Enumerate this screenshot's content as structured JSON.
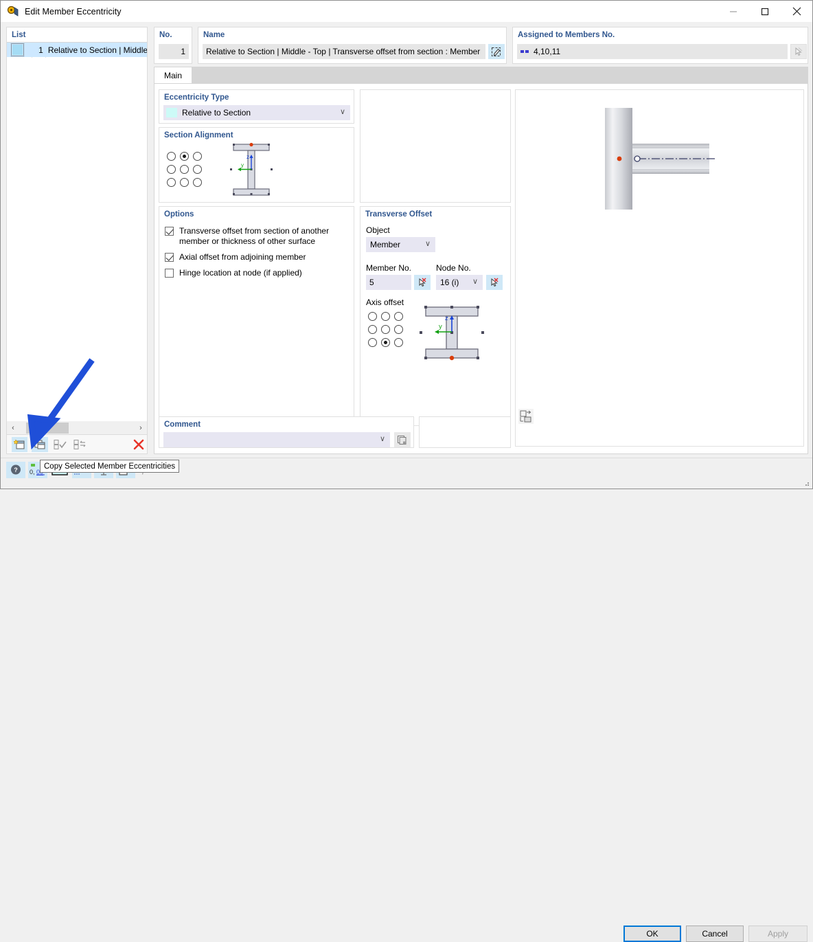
{
  "window": {
    "title": "Edit Member Eccentricity",
    "icon": "eccentricity-icon",
    "minimize": "—",
    "maximize": "☐",
    "close": "✕"
  },
  "list_panel": {
    "header": "List",
    "rows": [
      {
        "no": "1",
        "text": "Relative to Section | Middle - To"
      }
    ],
    "scroll_left": "‹",
    "scroll_right": "›",
    "toolbar": [
      {
        "name": "new-member-eccentricity-button",
        "glyph": "new"
      },
      {
        "name": "copy-selected-member-eccentricities-button",
        "glyph": "copy"
      },
      {
        "name": "select-all-button",
        "glyph": "check-all"
      },
      {
        "name": "invert-selection-button",
        "glyph": "invert"
      },
      {
        "name": "delete-button",
        "glyph": "delete"
      }
    ]
  },
  "no_panel": {
    "label": "No.",
    "value": "1"
  },
  "name_panel": {
    "label": "Name",
    "value": "Relative to Section | Middle - Top | Transverse offset from section : Member No",
    "edit_button": "edit-name-icon"
  },
  "assigned_panel": {
    "label": "Assigned to Members No.",
    "value": "4,10,11",
    "pick_button": "pick-members-icon"
  },
  "tabs": [
    {
      "label": "Main",
      "active": true
    }
  ],
  "eccentricity_type": {
    "label": "Eccentricity Type",
    "value": "Relative to Section",
    "swatch_color": "#ccfaf7",
    "chevron": "∨"
  },
  "section_alignment": {
    "label": "Section Alignment",
    "selected_index": 1,
    "cells": 9
  },
  "options": {
    "label": "Options",
    "items": [
      {
        "label": "Transverse offset from section of another member or thickness of other surface",
        "checked": true
      },
      {
        "label": "Axial offset from adjoining member",
        "checked": true
      },
      {
        "label": "Hinge location at node (if applied)",
        "checked": false
      }
    ]
  },
  "transverse_offset": {
    "label": "Transverse Offset",
    "object_label": "Object",
    "object_value": "Member",
    "member_no_label": "Member No.",
    "member_no_value": "5",
    "node_no_label": "Node No.",
    "node_no_value": "16 (i)",
    "axis_offset_label": "Axis offset",
    "axis_selected_index": 7,
    "chevron": "∨"
  },
  "comment": {
    "label": "Comment",
    "value": "",
    "chevron": "∨",
    "copy_button": "comment-copy-icon"
  },
  "preview": {
    "export_button": "export-view-icon"
  },
  "statusbar": {
    "icons": [
      {
        "name": "help-icon",
        "glyph": "?"
      },
      {
        "name": "number-format-icon",
        "glyph": "0,00"
      },
      {
        "name": "color-icon",
        "glyph": "color"
      },
      {
        "name": "font-icon",
        "glyph": "A"
      },
      {
        "name": "display-icon",
        "glyph": "display"
      },
      {
        "name": "report-icon",
        "glyph": "report"
      },
      {
        "name": "formula-icon",
        "glyph": "fx"
      }
    ],
    "buttons": {
      "ok": "OK",
      "cancel": "Cancel",
      "apply": "Apply"
    }
  },
  "tooltip": {
    "text": "Copy Selected Member Eccentricities"
  },
  "colors": {
    "accent": "#0078d7",
    "group_label": "#31578f",
    "selection": "#cde8ff",
    "field": "#e6e6e6",
    "field_lavender": "#e7e6f2",
    "icon_button": "#cfe8f7",
    "annotation_arrow": "#1f4fd8",
    "delete_red": "#e8342a"
  }
}
